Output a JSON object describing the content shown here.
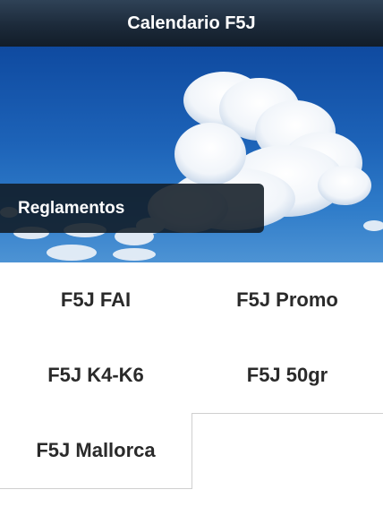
{
  "header": {
    "title": "Calendario F5J"
  },
  "hero": {
    "banner_label": "Reglamentos"
  },
  "menu": {
    "items": [
      {
        "label": "F5J FAI"
      },
      {
        "label": "F5J Promo"
      },
      {
        "label": "F5J K4-K6"
      },
      {
        "label": "F5J 50gr"
      },
      {
        "label": "F5J Mallorca"
      }
    ]
  },
  "colors": {
    "titlebar": "#1c2a3a",
    "sky": "#1d63b8",
    "banner": "#111b26",
    "cell_text": "#2a2a2a",
    "divider": "#cfcfcf"
  }
}
